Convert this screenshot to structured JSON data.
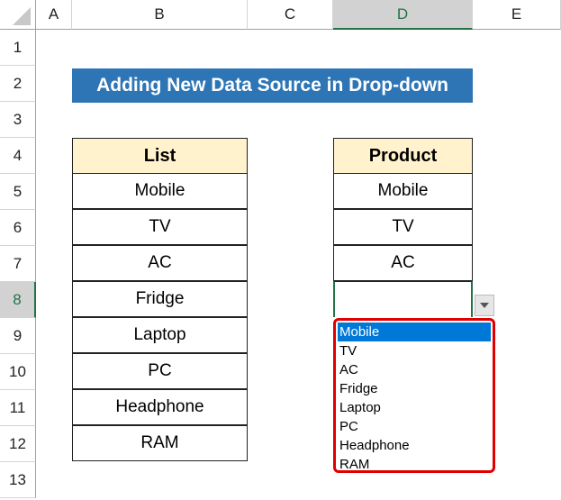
{
  "columns": [
    "A",
    "B",
    "C",
    "D",
    "E"
  ],
  "rows": [
    "1",
    "2",
    "3",
    "4",
    "5",
    "6",
    "7",
    "8",
    "9",
    "10",
    "11",
    "12",
    "13"
  ],
  "title": "Adding New Data Source in Drop-down",
  "list": {
    "header": "List",
    "items": [
      "Mobile",
      "TV",
      "AC",
      "Fridge",
      "Laptop",
      "PC",
      "Headphone",
      "RAM"
    ]
  },
  "product": {
    "header": "Product",
    "items": [
      "Mobile",
      "TV",
      "AC",
      ""
    ]
  },
  "dropdown": {
    "options": [
      "Mobile",
      "TV",
      "AC",
      "Fridge",
      "Laptop",
      "PC",
      "Headphone",
      "RAM"
    ],
    "highlighted": "Mobile"
  }
}
